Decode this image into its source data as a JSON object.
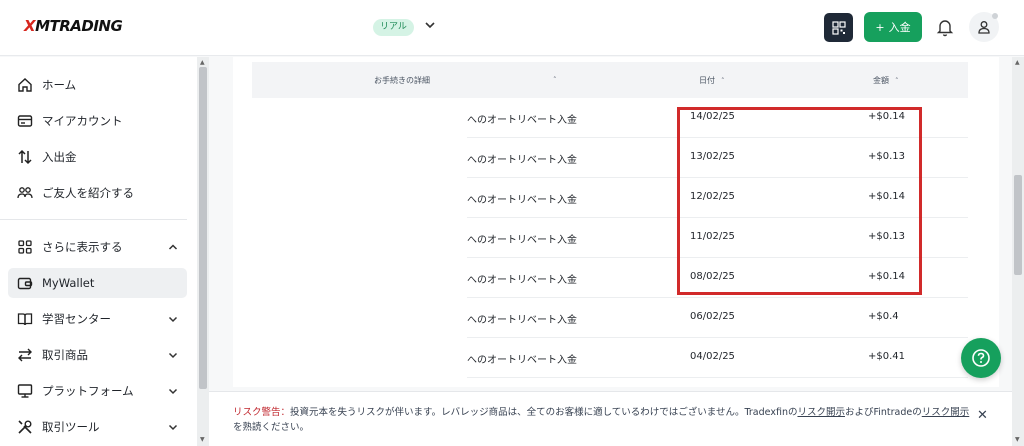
{
  "header": {
    "logo_mark": "X",
    "logo_text": "MTRADING",
    "account_type": "リアル",
    "deposit_label": "入金"
  },
  "sidebar": {
    "items": [
      {
        "label": "ホーム",
        "icon": "home-icon"
      },
      {
        "label": "マイアカウント",
        "icon": "card-icon"
      },
      {
        "label": "入出金",
        "icon": "transfer-icon"
      },
      {
        "label": "ご友人を紹介する",
        "icon": "users-icon"
      },
      {
        "label": "さらに表示する",
        "icon": "grid-icon"
      },
      {
        "label": "MyWallet",
        "icon": "wallet-icon"
      },
      {
        "label": "学習センター",
        "icon": "book-icon"
      },
      {
        "label": "取引商品",
        "icon": "swap-icon"
      },
      {
        "label": "プラットフォーム",
        "icon": "monitor-icon"
      },
      {
        "label": "取引ツール",
        "icon": "tools-icon"
      }
    ]
  },
  "table": {
    "headers": {
      "details": "お手続きの詳細",
      "date": "日付",
      "amount": "金額"
    },
    "rows": [
      {
        "desc": "へのオートリベート入金",
        "date": "14/02/25",
        "amount": "+$0.14"
      },
      {
        "desc": "へのオートリベート入金",
        "date": "13/02/25",
        "amount": "+$0.13"
      },
      {
        "desc": "へのオートリベート入金",
        "date": "12/02/25",
        "amount": "+$0.14"
      },
      {
        "desc": "へのオートリベート入金",
        "date": "11/02/25",
        "amount": "+$0.13"
      },
      {
        "desc": "へのオートリベート入金",
        "date": "08/02/25",
        "amount": "+$0.14"
      },
      {
        "desc": "へのオートリベート入金",
        "date": "06/02/25",
        "amount": "+$0.4"
      },
      {
        "desc": "へのオートリベート入金",
        "date": "04/02/25",
        "amount": "+$0.41"
      }
    ]
  },
  "risk": {
    "label": "リスク警告：",
    "text1": "投資元本を失うリスクが伴います。レバレッジ商品は、全てのお客様に適しているわけではございません。Tradexfinの",
    "link1": "リスク開示",
    "text2": "およびFintradeの",
    "link2": "リスク開示",
    "text3": "を熟読ください。"
  },
  "colors": {
    "accent": "#16a05d",
    "highlight": "#d12a2a",
    "dark_button": "#1f2937"
  }
}
